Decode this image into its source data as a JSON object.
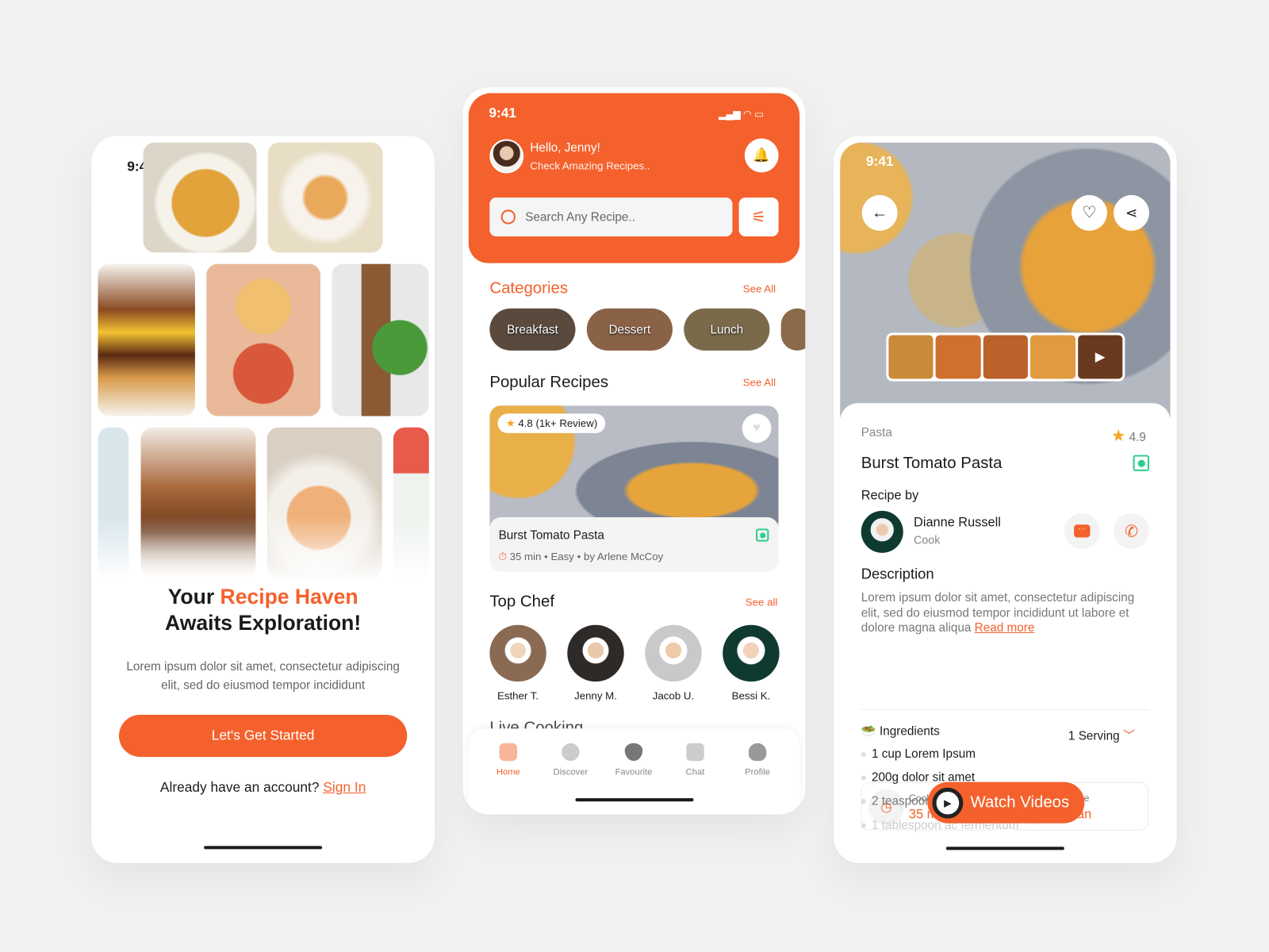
{
  "colors": {
    "accent": "#f4612c",
    "background": "#f1f1f1",
    "veg": "#2ecc8f"
  },
  "status_time": "9:41",
  "onboarding": {
    "title_part1": "Your ",
    "title_accent": "Recipe Haven",
    "title_line2": "Awaits Exploration!",
    "body": "Lorem ipsum dolor sit amet, consectetur adipiscing elit, sed do eiusmod tempor incididunt",
    "cta": "Let's Get Started",
    "signin_prompt": "Already have an account?",
    "signin_link": "Sign In"
  },
  "home": {
    "greeting": "Hello, Jenny!",
    "subtitle": "Check Amazing Recipes..",
    "search_placeholder": "Search Any Recipe..",
    "categories_title": "Categories",
    "see_all": "See All",
    "see_all_lower": "See all",
    "categories": [
      "Breakfast",
      "Dessert",
      "Lunch"
    ],
    "popular_title": "Popular Recipes",
    "popular": {
      "rating": "4.8 (1k+ Review)",
      "name": "Burst Tomato Pasta",
      "meta": "35 min • Easy • by Arlene McCoy"
    },
    "top_chef_title": "Top Chef",
    "chefs": [
      "Esther T.",
      "Jenny M.",
      "Jacob U.",
      "Bessi K."
    ],
    "live_title": "Live Cooking",
    "nav": [
      {
        "label": "Home",
        "icon": "home-icon",
        "active": true
      },
      {
        "label": "Discover",
        "icon": "compass-icon"
      },
      {
        "label": "Favourite",
        "icon": "heart-icon"
      },
      {
        "label": "Chat",
        "icon": "chat-icon"
      },
      {
        "label": "Profile",
        "icon": "user-icon"
      }
    ]
  },
  "detail": {
    "category": "Pasta",
    "rating": "4.9",
    "name": "Burst Tomato Pasta",
    "recipe_by": "Recipe by",
    "chef_name": "Dianne Russell",
    "chef_role": "Cook",
    "description_title": "Description",
    "description": "Lorem ipsum dolor sit amet, consectetur adipiscing elit, sed do eiusmod tempor incididunt ut labore et dolore magna aliqua ",
    "read_more": "Read more",
    "cooking_time_label": "Cooking Time",
    "cooking_time": "35 min",
    "cuisine_label": "Cuisine",
    "cuisine": "Italian",
    "ingredients_title": "Ingredients",
    "serving": "1 Serving",
    "ingredients": [
      "1 cup Lorem Ipsum",
      "200g dolor sit amet",
      "2 teaspoon",
      "1 tablespoon ac fermentum"
    ],
    "watch_videos": "Watch Videos"
  }
}
